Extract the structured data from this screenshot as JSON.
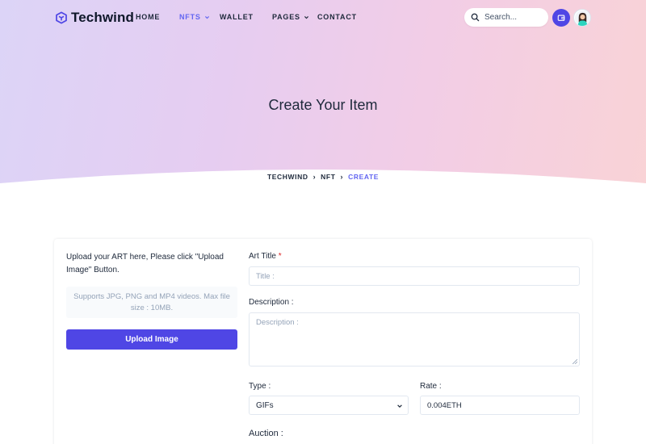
{
  "brand": {
    "name": "Techwind",
    "accent": "#4f46e5",
    "logo_icon": "hexagon-logo-icon"
  },
  "nav": {
    "items": [
      {
        "label": "HOME",
        "has_dropdown": false,
        "active": false
      },
      {
        "label": "NFTS",
        "has_dropdown": true,
        "active": true
      },
      {
        "label": "WALLET",
        "has_dropdown": false,
        "active": false
      },
      {
        "label": "PAGES",
        "has_dropdown": true,
        "active": false
      },
      {
        "label": "CONTACT",
        "has_dropdown": false,
        "active": false
      }
    ],
    "search_placeholder": "Search...",
    "wallet_icon": "wallet-icon",
    "avatar_icon": "user-avatar"
  },
  "hero": {
    "title": "Create Your Item",
    "breadcrumb": [
      "TECHWIND",
      "NFT",
      "CREATE"
    ]
  },
  "upload": {
    "note": "Upload your ART here, Please click \"Upload Image\" Button.",
    "preview_text": "Supports JPG, PNG and MP4 videos. Max file size : 10MB.",
    "button_label": "Upload Image"
  },
  "form": {
    "title_label": "Art Title",
    "title_required_mark": "*",
    "title_placeholder": "Title :",
    "description_label": "Description :",
    "description_placeholder": "Description :",
    "type_label": "Type :",
    "type_selected": "GIFs",
    "rate_label": "Rate :",
    "rate_value": "0.004ETH",
    "auction_label": "Auction :"
  }
}
